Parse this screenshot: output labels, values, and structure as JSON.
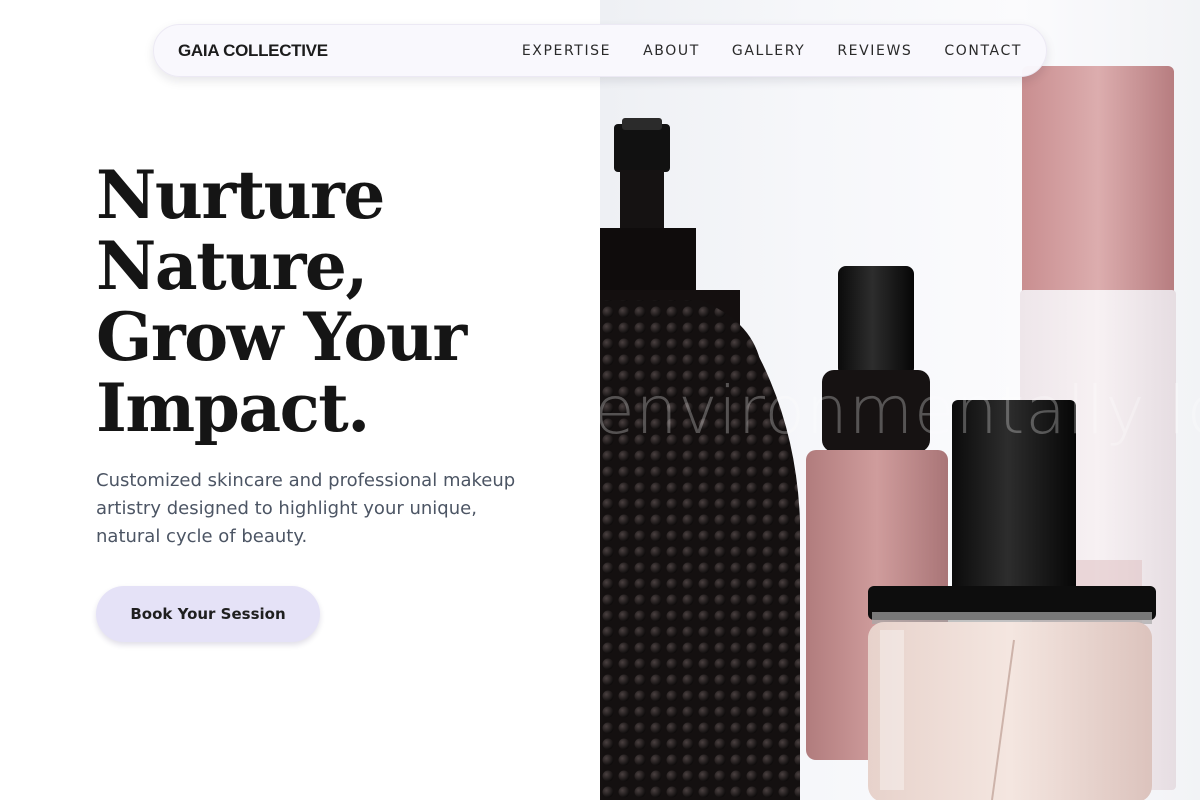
{
  "nav": {
    "brand": "GAIA COLLECTIVE",
    "links": [
      "EXPERTISE",
      "ABOUT",
      "GALLERY",
      "REVIEWS",
      "CONTACT"
    ]
  },
  "hero": {
    "headline_lines": [
      "Nurture",
      "Nature,",
      "Grow Your",
      "Impact."
    ],
    "subtitle": "Customized skincare and professional makeup artistry designed to highlight your unique, natural cycle of beauty.",
    "cta_label": "Book Your Session",
    "image_overlay_text": "environmentally lov"
  },
  "colors": {
    "cta_background": "#e5e2f7",
    "headline": "#151515",
    "subtitle": "#4c5564",
    "nav_background": "#f9f8fd"
  }
}
